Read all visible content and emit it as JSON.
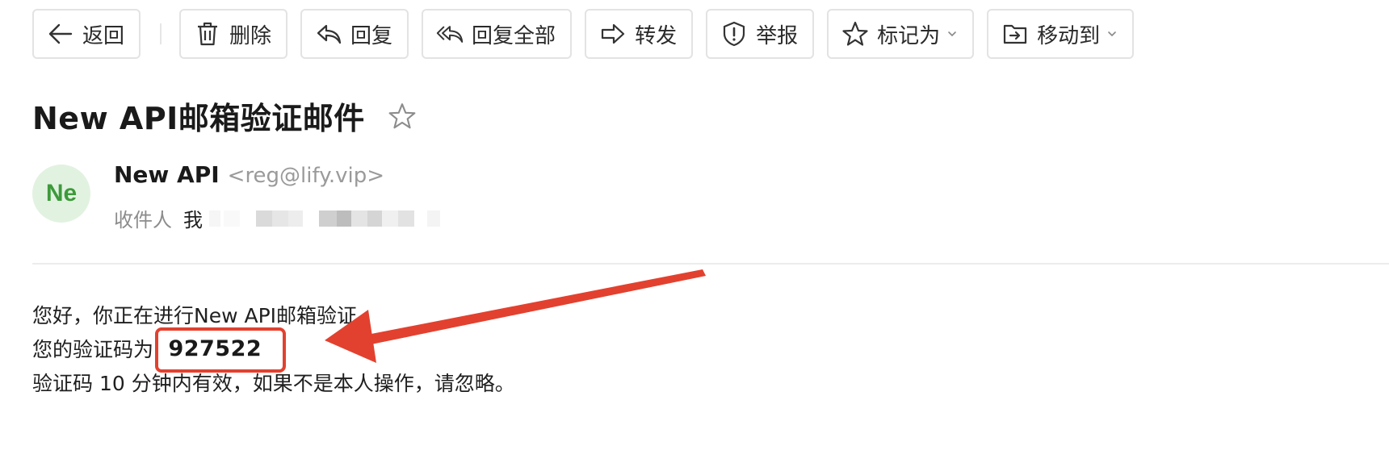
{
  "toolbar": {
    "back": {
      "label": "返回",
      "icon": "arrow-left-icon"
    },
    "delete": {
      "label": "删除",
      "icon": "trash-icon"
    },
    "reply": {
      "label": "回复",
      "icon": "reply-icon"
    },
    "reply_all": {
      "label": "回复全部",
      "icon": "reply-all-icon"
    },
    "forward": {
      "label": "转发",
      "icon": "forward-icon"
    },
    "report": {
      "label": "举报",
      "icon": "shield-alert-icon"
    },
    "mark_as": {
      "label": "标记为",
      "icon": "star-outline-icon"
    },
    "move_to": {
      "label": "移动到",
      "icon": "folder-move-icon"
    }
  },
  "message": {
    "subject": "New API邮箱验证邮件",
    "sender": {
      "avatar_text": "Ne",
      "name": "New API",
      "email": "<reg@lify.vip>"
    },
    "recipient": {
      "label": "收件人",
      "me": "我"
    },
    "body": {
      "greeting": "您好，你正在进行New API邮箱验证。",
      "code_label": "您的验证码为: ",
      "code": "927522",
      "note": "验证码 10 分钟内有效，如果不是本人操作，请忽略。"
    }
  },
  "colors": {
    "annotation": "#e2412f",
    "avatar_bg": "#e2f2e1",
    "avatar_text": "#3d9a3a"
  }
}
